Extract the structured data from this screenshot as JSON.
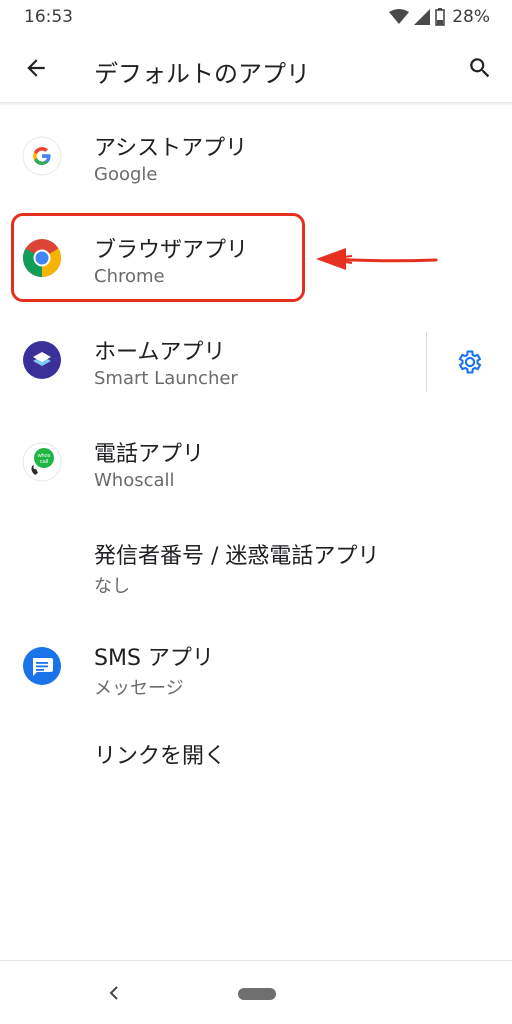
{
  "status_bar": {
    "time": "16:53",
    "battery": "28%"
  },
  "app_bar": {
    "title": "デフォルトのアプリ",
    "back_icon": "arrow-back-icon",
    "search_icon": "search-icon"
  },
  "items": [
    {
      "title": "アシストアプリ",
      "subtitle": "Google",
      "icon": "google-icon"
    },
    {
      "title": "ブラウザアプリ",
      "subtitle": "Chrome",
      "icon": "chrome-icon"
    },
    {
      "title": "ホームアプリ",
      "subtitle": "Smart Launcher",
      "icon": "smart-launcher-icon",
      "action_icon": "gear-icon"
    },
    {
      "title": "電話アプリ",
      "subtitle": "Whoscall",
      "icon": "whoscall-icon",
      "icon_text": "whos call"
    },
    {
      "title": "発信者番号 / 迷惑電話アプリ",
      "subtitle": "なし"
    },
    {
      "title": "SMS アプリ",
      "subtitle": "メッセージ",
      "icon": "messages-icon"
    },
    {
      "title": "リンクを開く"
    }
  ],
  "colors": {
    "accent": "#1a73e8",
    "annotation": "#e53020"
  }
}
